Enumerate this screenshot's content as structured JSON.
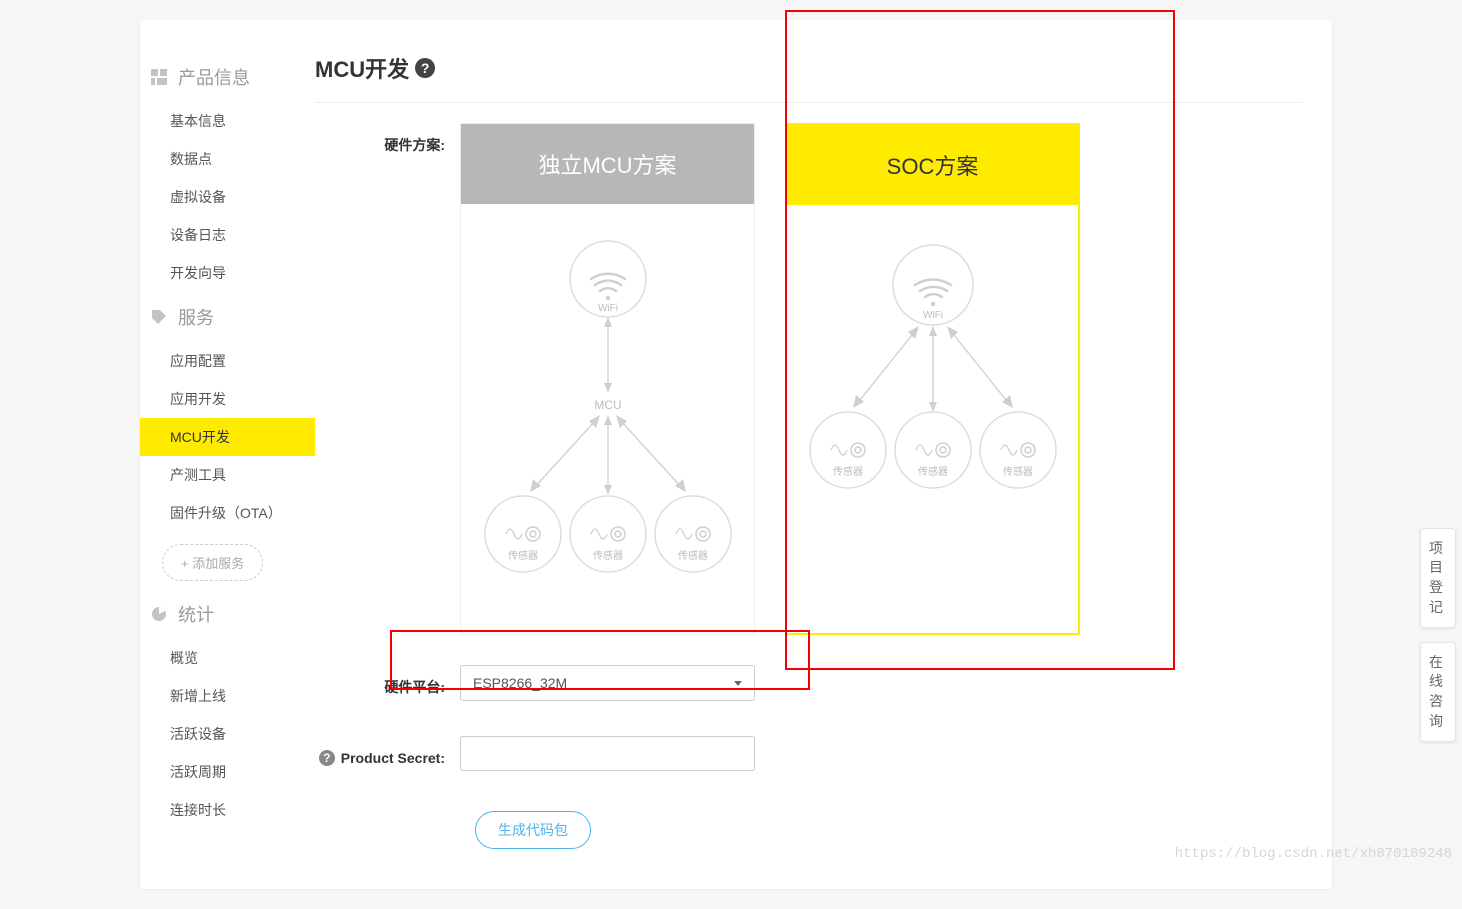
{
  "page_title": "MCU开发",
  "sidebar": {
    "section1": {
      "title": "产品信息",
      "items": [
        "基本信息",
        "数据点",
        "虚拟设备",
        "设备日志",
        "开发向导"
      ]
    },
    "section2": {
      "title": "服务",
      "items": [
        "应用配置",
        "应用开发",
        "MCU开发",
        "产测工具",
        "固件升级（OTA）"
      ],
      "add_label": "+ 添加服务"
    },
    "section3": {
      "title": "统计",
      "items": [
        "概览",
        "新增上线",
        "活跃设备",
        "活跃周期",
        "连接时长"
      ]
    }
  },
  "form": {
    "hw_scheme_label": "硬件方案:",
    "option_a": "独立MCU方案",
    "option_b": "SOC方案",
    "wifi_label": "WiFi",
    "mcu_label": "MCU",
    "sensor_label": "传感器",
    "hw_platform_label": "硬件平台:",
    "hw_platform_value": "ESP8266_32M",
    "secret_label": "Product Secret:",
    "secret_value": ""
  },
  "generate_btn": "生成代码包",
  "float_tab1": "项目登记",
  "float_tab2": "在线咨询",
  "watermark": "https://blog.csdn.net/xh870189248"
}
